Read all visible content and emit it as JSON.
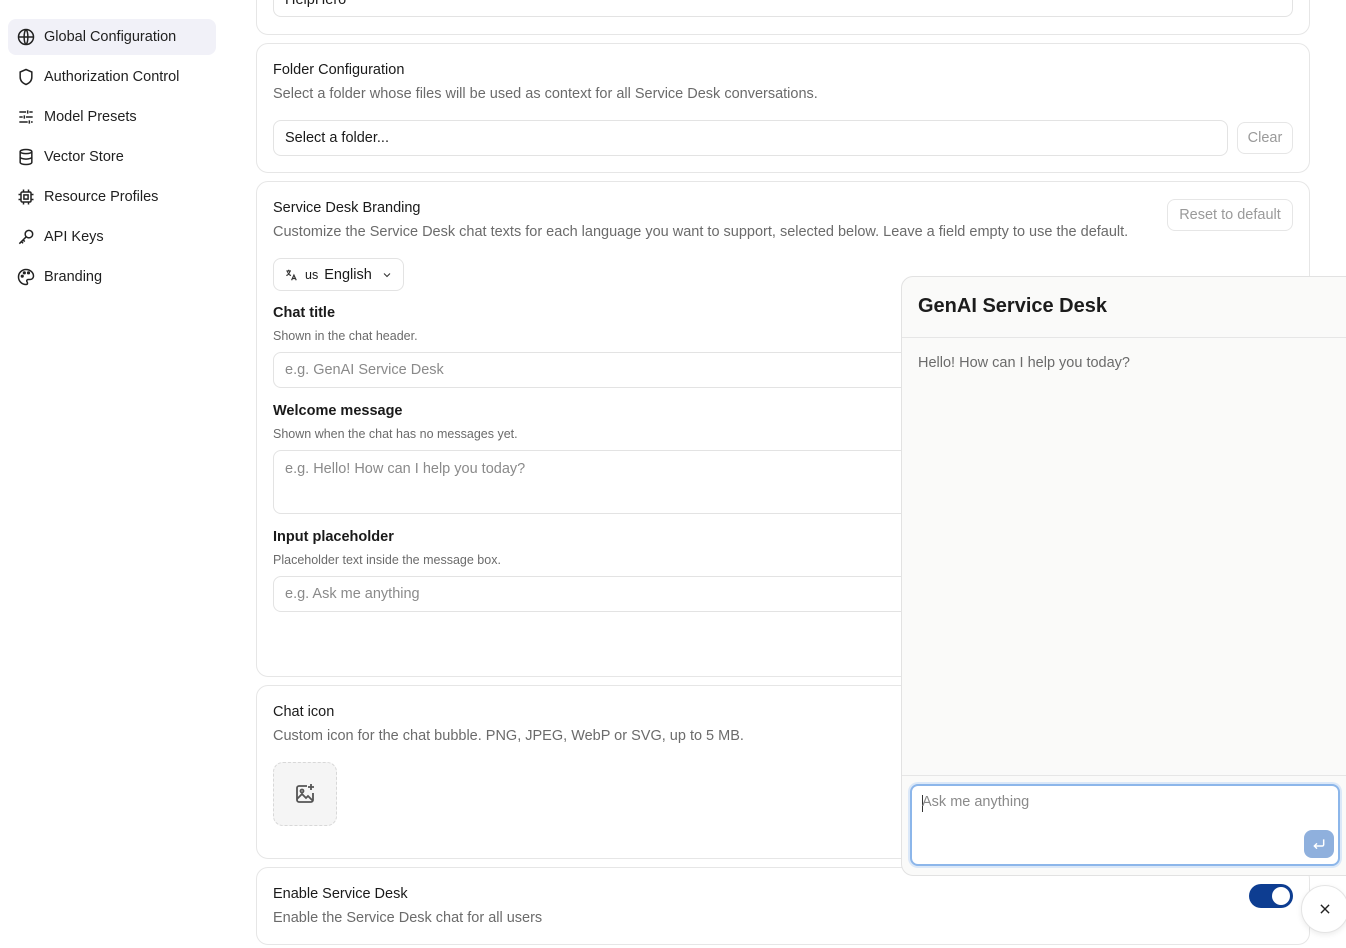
{
  "sidebar": {
    "items": [
      {
        "label": "Global Configuration",
        "icon": "globe-icon",
        "active": true
      },
      {
        "label": "Authorization Control",
        "icon": "shield-icon"
      },
      {
        "label": "Model Presets",
        "icon": "sliders-icon"
      },
      {
        "label": "Vector Store",
        "icon": "database-icon"
      },
      {
        "label": "Resource Profiles",
        "icon": "chip-icon"
      },
      {
        "label": "API Keys",
        "icon": "key-icon"
      },
      {
        "label": "Branding",
        "icon": "palette-icon"
      }
    ]
  },
  "top_card": {
    "input_value": "HelpHero"
  },
  "folder_config": {
    "title": "Folder Configuration",
    "description": "Select a folder whose files will be used as context for all Service Desk conversations.",
    "select_placeholder": "Select a folder...",
    "clear_label": "Clear"
  },
  "branding": {
    "title": "Service Desk Branding",
    "description": "Customize the Service Desk chat texts for each language you want to support, selected below. Leave a field empty to use the default.",
    "reset_label": "Reset to default",
    "language_code": "us",
    "language_label": "English",
    "chat_title_label": "Chat title",
    "chat_title_hint": "Shown in the chat header.",
    "chat_title_placeholder": "e.g. GenAI Service Desk",
    "welcome_label": "Welcome message",
    "welcome_hint": "Shown when the chat has no messages yet.",
    "welcome_placeholder": "e.g. Hello! How can I help you today?",
    "input_ph_label": "Input placeholder",
    "input_ph_hint": "Placeholder text inside the message box.",
    "input_ph_placeholder": "e.g. Ask me anything"
  },
  "chat_icon": {
    "title": "Chat icon",
    "description": "Custom icon for the chat bubble. PNG, JPEG, WebP or SVG, up to 5 MB."
  },
  "enable": {
    "title": "Enable Service Desk",
    "description": "Enable the Service Desk chat for all users",
    "enabled": true
  },
  "chat_preview": {
    "title": "GenAI Service Desk",
    "welcome": "Hello! How can I help you today?",
    "placeholder": "Ask me anything"
  },
  "colors": {
    "accent": "#0d3d91",
    "send_button": "#8fb0dd",
    "active_nav_bg": "#f1f1f8"
  }
}
